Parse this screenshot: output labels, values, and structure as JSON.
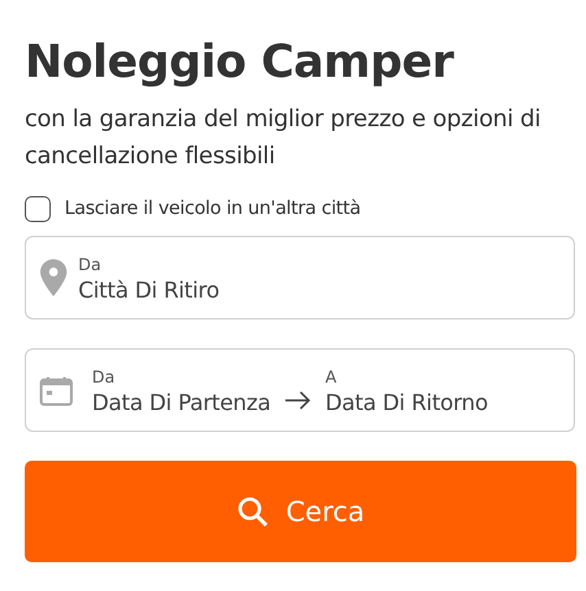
{
  "title": "Noleggio Camper",
  "subtitle": "con la garanzia del miglior prezzo e opzioni di cancellazione flessibili",
  "return_elsewhere": {
    "label": "Lasciare il veicolo in un'altra città",
    "checked": false
  },
  "pickup": {
    "label": "Da",
    "placeholder": "Città Di Ritiro"
  },
  "dates": {
    "from": {
      "label": "Da",
      "placeholder": "Data Di Partenza"
    },
    "to": {
      "label": "A",
      "placeholder": "Data Di Ritorno"
    }
  },
  "search_button": {
    "label": "Cerca"
  }
}
